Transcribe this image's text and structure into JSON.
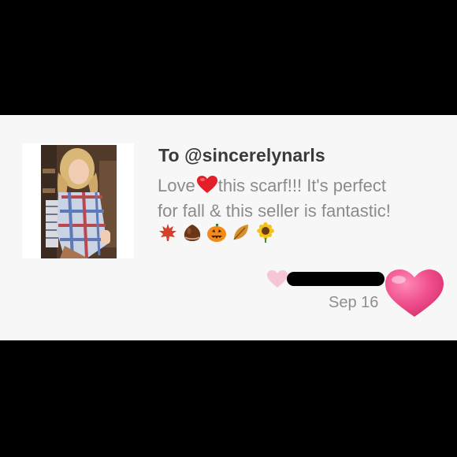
{
  "review": {
    "recipient_prefix": "To",
    "recipient": "@sincerelynarls",
    "title": "To @sincerelynarls",
    "message_part1": "Love",
    "message_heart": "heart-emoji",
    "message_part2": "this scarf!!! It's perfect",
    "message_line2": "for fall & this seller is fantastic!",
    "emojis": [
      "maple-leaf-emoji",
      "chestnut-emoji",
      "jack-o-lantern-emoji",
      "fallen-leaf-emoji",
      "sunflower-emoji"
    ],
    "date": "Sep 16"
  },
  "reviewer": {
    "username_redacted": true
  },
  "colors": {
    "card_bg": "#f8f7f8",
    "title_text": "#3a3a3a",
    "body_text": "#8b8b8b",
    "like_heart": "#f0508e",
    "small_heart": "#f7c6d6"
  }
}
